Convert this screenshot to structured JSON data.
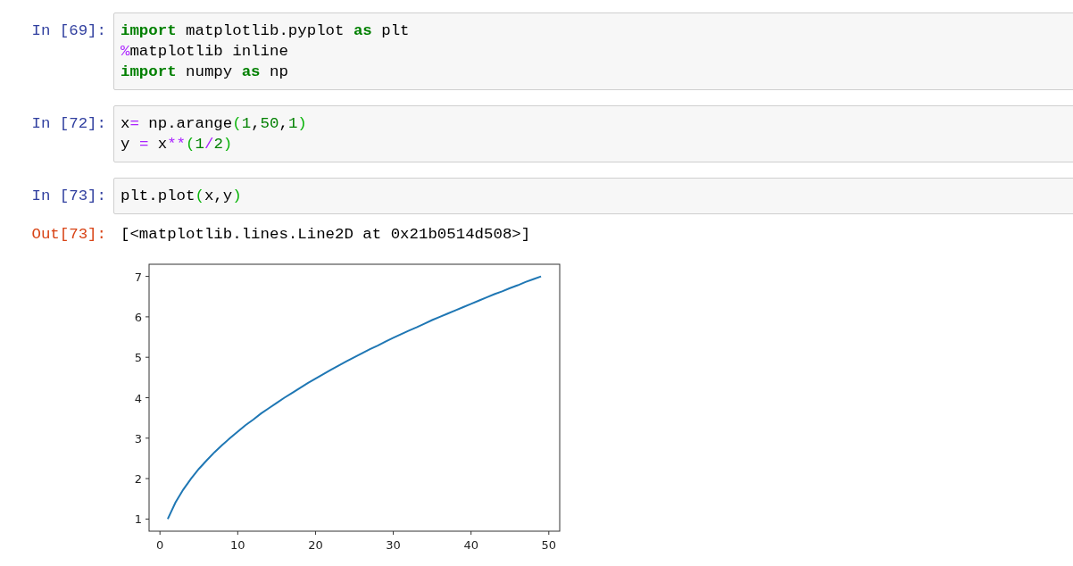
{
  "cells": [
    {
      "prompt": "In [69]:",
      "lines": [
        [
          {
            "text": "import",
            "kind": "keyword"
          },
          {
            "text": " matplotlib.pyplot ",
            "kind": "plain"
          },
          {
            "text": "as",
            "kind": "keyword"
          },
          {
            "text": " plt",
            "kind": "plain"
          }
        ],
        [
          {
            "text": "%",
            "kind": "operator"
          },
          {
            "text": "matplotlib inline",
            "kind": "plain"
          }
        ],
        [
          {
            "text": "import",
            "kind": "keyword"
          },
          {
            "text": " numpy ",
            "kind": "plain"
          },
          {
            "text": "as",
            "kind": "keyword"
          },
          {
            "text": " np",
            "kind": "plain"
          }
        ]
      ]
    },
    {
      "prompt": "In [72]:",
      "lines": [
        [
          {
            "text": "x",
            "kind": "plain"
          },
          {
            "text": "=",
            "kind": "operator"
          },
          {
            "text": " np.arange",
            "kind": "plain"
          },
          {
            "text": "(",
            "kind": "bracket"
          },
          {
            "text": "1",
            "kind": "number"
          },
          {
            "text": ",",
            "kind": "plain"
          },
          {
            "text": "50",
            "kind": "number"
          },
          {
            "text": ",",
            "kind": "plain"
          },
          {
            "text": "1",
            "kind": "number"
          },
          {
            "text": ")",
            "kind": "bracket"
          }
        ],
        [
          {
            "text": "y ",
            "kind": "plain"
          },
          {
            "text": "=",
            "kind": "operator"
          },
          {
            "text": " x",
            "kind": "plain"
          },
          {
            "text": "**",
            "kind": "operator"
          },
          {
            "text": "(",
            "kind": "bracket"
          },
          {
            "text": "1",
            "kind": "number"
          },
          {
            "text": "/",
            "kind": "operator"
          },
          {
            "text": "2",
            "kind": "number"
          },
          {
            "text": ")",
            "kind": "bracket"
          }
        ]
      ]
    },
    {
      "prompt": "In [73]:",
      "lines": [
        [
          {
            "text": "plt.plot",
            "kind": "plain"
          },
          {
            "text": "(",
            "kind": "bracket"
          },
          {
            "text": "x,y",
            "kind": "plain"
          },
          {
            "text": ")",
            "kind": "bracket"
          }
        ]
      ]
    }
  ],
  "output": {
    "prompt": "Out[73]:",
    "text": "[<matplotlib.lines.Line2D at 0x21b0514d508>]",
    "chart_data": {
      "type": "line",
      "x": [
        1,
        2,
        3,
        4,
        5,
        6,
        7,
        8,
        9,
        10,
        11,
        12,
        13,
        14,
        15,
        16,
        17,
        18,
        19,
        20,
        21,
        22,
        23,
        24,
        25,
        26,
        27,
        28,
        29,
        30,
        31,
        32,
        33,
        34,
        35,
        36,
        37,
        38,
        39,
        40,
        41,
        42,
        43,
        44,
        45,
        46,
        47,
        48,
        49
      ],
      "series": [
        {
          "color": "#1f77b4",
          "values": [
            1,
            1.41,
            1.73,
            2,
            2.24,
            2.45,
            2.65,
            2.83,
            3,
            3.16,
            3.32,
            3.46,
            3.61,
            3.74,
            3.87,
            4,
            4.12,
            4.24,
            4.36,
            4.47,
            4.58,
            4.69,
            4.8,
            4.9,
            5,
            5.1,
            5.2,
            5.29,
            5.39,
            5.48,
            5.57,
            5.66,
            5.74,
            5.83,
            5.92,
            6,
            6.08,
            6.16,
            6.24,
            6.32,
            6.4,
            6.48,
            6.56,
            6.63,
            6.71,
            6.78,
            6.86,
            6.93,
            7
          ]
        }
      ],
      "xlim": [
        -1.4,
        51.4
      ],
      "ylim": [
        0.7,
        7.3
      ],
      "xticks": [
        0,
        10,
        20,
        30,
        40,
        50
      ],
      "yticks": [
        1,
        2,
        3,
        4,
        5,
        6,
        7
      ]
    }
  }
}
